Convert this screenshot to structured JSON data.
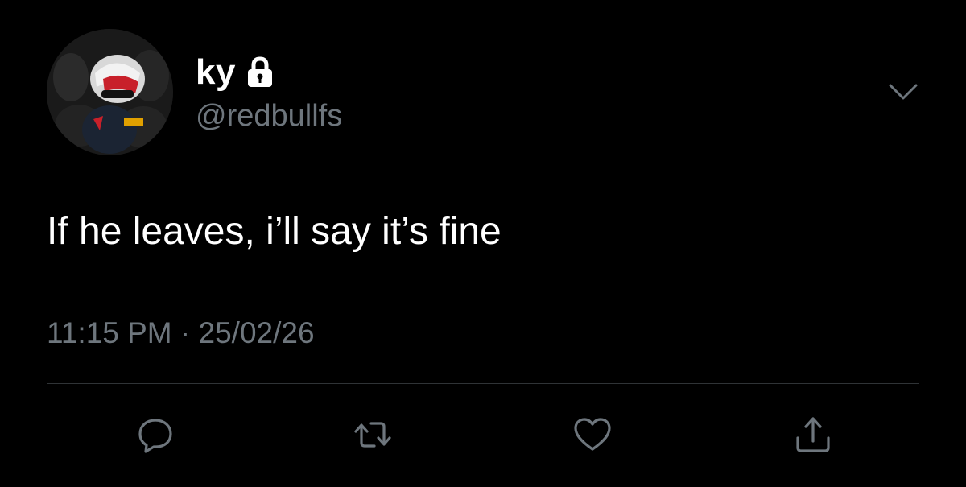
{
  "user": {
    "display_name": "ky",
    "handle": "@redbullfs",
    "protected_icon": "lock-icon",
    "avatar_icon": "avatar-photo"
  },
  "tweet": {
    "text": "If he leaves, i’ll say it’s fine",
    "timestamp": "11:15 PM · 25/02/26"
  },
  "menu_icon": "chevron-down-icon",
  "actions": {
    "reply_icon": "comment-icon",
    "retweet_icon": "retweet-icon",
    "like_icon": "heart-icon",
    "share_icon": "share-icon"
  },
  "colors": {
    "background": "#000000",
    "primary_text": "#ffffff",
    "secondary_text": "#6e767d",
    "divider": "#2f3336",
    "icon": "#6e767d"
  }
}
